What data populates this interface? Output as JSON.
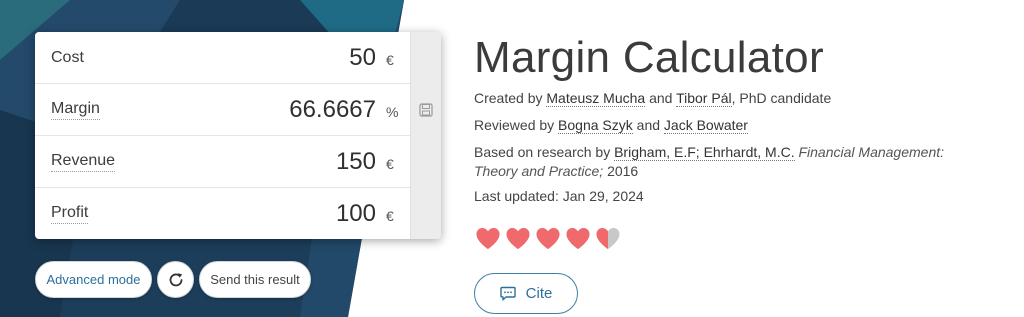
{
  "colors": {
    "accent": "#2b6f9b",
    "heart": "#f06a6d",
    "heart_empty": "#c8c8c8",
    "bg_dark": "#1b3c57"
  },
  "calculator": {
    "rows": [
      {
        "label": "Cost",
        "value": "50",
        "unit": "€"
      },
      {
        "label": "Margin",
        "value": "66.6667",
        "unit": "%"
      },
      {
        "label": "Revenue",
        "value": "150",
        "unit": "€"
      },
      {
        "label": "Profit",
        "value": "100",
        "unit": "€"
      }
    ],
    "side_icon": "save-icon"
  },
  "buttons": {
    "advanced": "Advanced mode",
    "reload_icon": "reload-icon",
    "send": "Send this result"
  },
  "header": {
    "title": "Margin Calculator",
    "created_prefix": "Created by",
    "author1": "Mateusz Mucha",
    "and1": "and",
    "author2": "Tibor Pál",
    "author2_suffix": ", PhD candidate",
    "reviewed_prefix": "Reviewed by",
    "reviewer1": "Bogna Szyk",
    "and2": "and",
    "reviewer2": "Jack Bowater",
    "research_prefix": "Based on research by",
    "research_authors": "Brigham, E.F; Ehrhardt, M.C.",
    "research_title": "Financial Management: Theory and Practice;",
    "research_year": "2016",
    "updated": "Last updated: Jan 29, 2024"
  },
  "rating": {
    "value": 4.5,
    "max": 5
  },
  "cite": {
    "label": "Cite",
    "icon": "comment-icon"
  }
}
